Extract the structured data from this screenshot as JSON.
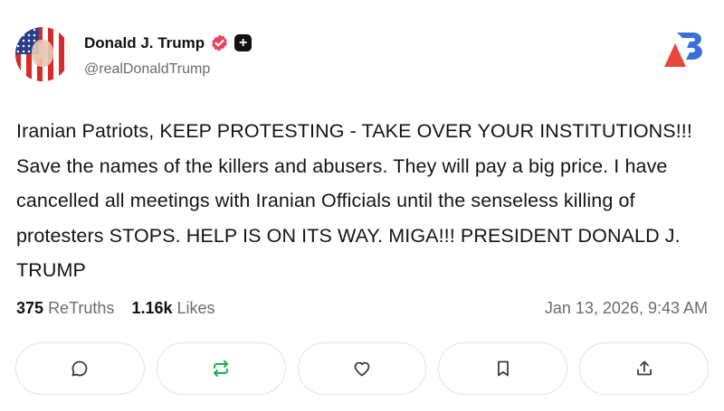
{
  "post": {
    "author_name": "Donald J. Trump",
    "handle": "@realDonaldTrump",
    "text": "Iranian Patriots, KEEP PROTESTING - TAKE OVER YOUR INSTITUTIONS!!! Save the names of the killers and abusers. They will pay a big price. I have cancelled all meetings with Iranian Officials until the senseless killing of protesters STOPS. HELP IS ON ITS WAY. MIGA!!! PRESIDENT DONALD J. TRUMP",
    "stats": {
      "retruths_count": "375",
      "retruths_label": "ReTruths",
      "likes_count": "1.16k",
      "likes_label": "Likes"
    },
    "timestamp": "Jan 13, 2026, 9:43 AM"
  },
  "badges": {
    "verified_color": "#e8455e",
    "plus_symbol": "+"
  },
  "actions": [
    {
      "icon": "comment-icon"
    },
    {
      "icon": "retruth-icon",
      "color": "#19b34a"
    },
    {
      "icon": "heart-icon"
    },
    {
      "icon": "bookmark-icon"
    },
    {
      "icon": "share-icon"
    }
  ],
  "colors": {
    "text": "#141414",
    "muted": "#6b6b70",
    "border": "#e3e3e6",
    "brand_red": "#e8453c",
    "brand_blue": "#3b6fd8"
  }
}
